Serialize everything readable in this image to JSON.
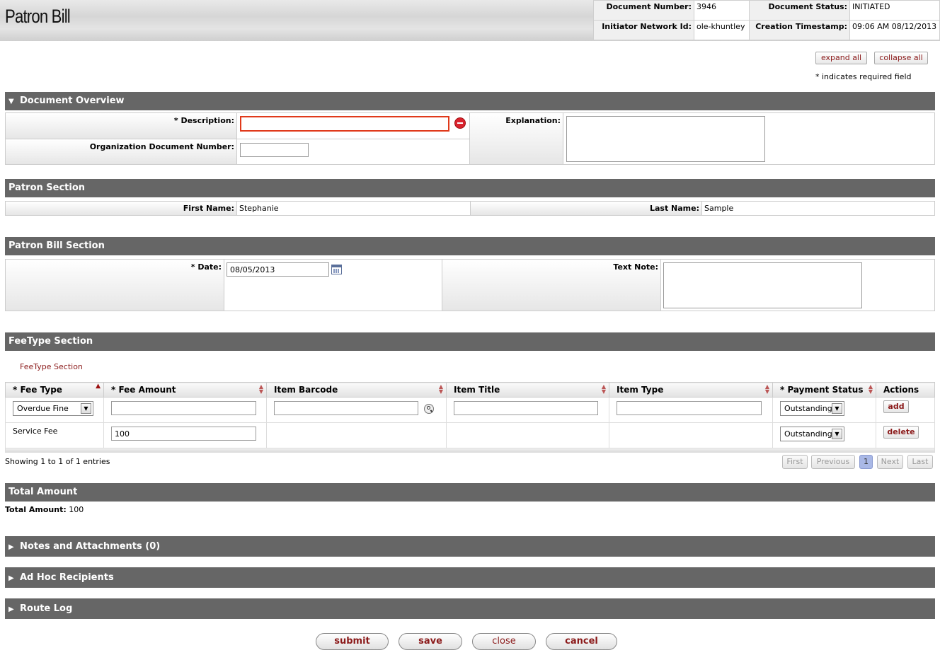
{
  "header": {
    "title": "Patron Bill",
    "doc_number_label": "Document Number:",
    "doc_number": "3946",
    "doc_status_label": "Document Status:",
    "doc_status": "INITIATED",
    "initiator_label": "Initiator Network Id:",
    "initiator": "ole-khuntley",
    "timestamp_label": "Creation Timestamp:",
    "timestamp": "09:06 AM 08/12/2013"
  },
  "top_actions": {
    "expand_all": "expand all",
    "collapse_all": "collapse all",
    "required_note": "* indicates required field"
  },
  "document_overview": {
    "title": "Document Overview",
    "description_label": "* Description:",
    "description_value": "",
    "org_doc_number_label": "Organization Document Number:",
    "org_doc_number_value": "",
    "explanation_label": "Explanation:",
    "explanation_value": ""
  },
  "patron_section": {
    "title": "Patron Section",
    "first_name_label": "First Name:",
    "first_name": "Stephanie",
    "last_name_label": "Last Name:",
    "last_name": "Sample"
  },
  "patron_bill_section": {
    "title": "Patron Bill Section",
    "date_label": "* Date:",
    "date_value": "08/05/2013",
    "text_note_label": "Text Note:",
    "text_note_value": ""
  },
  "fee_type_section": {
    "title": "FeeType Section",
    "subtitle": "FeeType Section",
    "columns": [
      "* Fee Type",
      "* Fee Amount",
      "Item Barcode",
      "Item Title",
      "Item Type",
      "* Payment Status",
      "Actions"
    ],
    "add_row": {
      "fee_type": "Overdue Fine",
      "fee_amount": "",
      "item_barcode": "",
      "item_title": "",
      "item_type": "",
      "payment_status": "Outstanding",
      "action": "add"
    },
    "rows": [
      {
        "fee_type": "Service Fee",
        "fee_amount": "100",
        "payment_status": "Outstanding",
        "action": "delete"
      }
    ],
    "showing_text": "Showing 1 to 1 of 1 entries",
    "pagination": {
      "first": "First",
      "previous": "Previous",
      "current": "1",
      "next": "Next",
      "last": "Last"
    }
  },
  "total_amount_section": {
    "title": "Total Amount",
    "label": "Total Amount:",
    "value": "100"
  },
  "collapsed_sections": {
    "notes": "Notes and Attachments (0)",
    "adhoc": "Ad Hoc Recipients",
    "route_log": "Route Log"
  },
  "bottom_buttons": {
    "submit": "submit",
    "save": "save",
    "close": "close",
    "cancel": "cancel"
  },
  "colors": {
    "section_bar": "#666666",
    "button_text": "#8b1a1a",
    "error_border": "#e0391a"
  }
}
